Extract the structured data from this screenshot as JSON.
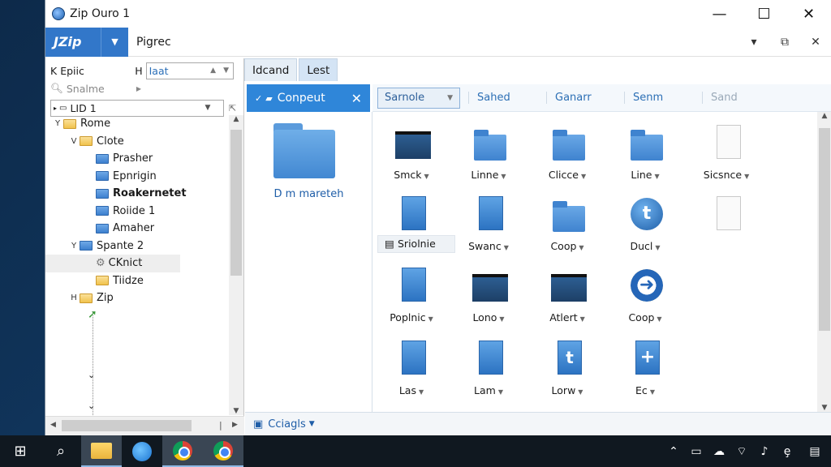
{
  "window": {
    "title": "Zip Ouro 1"
  },
  "ribbon": {
    "app_menu": "JZip",
    "tab": "Pigrec"
  },
  "left": {
    "row1": {
      "icon_label": "K",
      "left_text": "Epiic",
      "right_prefix": "H",
      "right_text": "Iaat"
    },
    "row2": {
      "text": "Snalme"
    },
    "address": {
      "value": "LID 1"
    },
    "tree": [
      {
        "label": "Rome",
        "indent": 0,
        "toggle": "Y",
        "folder": "yellow"
      },
      {
        "label": "Clote",
        "indent": 1,
        "toggle": "V",
        "folder": "yellow"
      },
      {
        "label": "Prasher",
        "indent": 2,
        "toggle": "",
        "folder": "blue"
      },
      {
        "label": "Epnrigin",
        "indent": 2,
        "toggle": "",
        "folder": "blue"
      },
      {
        "label": "Roakernetet",
        "indent": 2,
        "toggle": "",
        "folder": "blue",
        "bold": true
      },
      {
        "label": "Roiide 1",
        "indent": 2,
        "toggle": "",
        "folder": "blue"
      },
      {
        "label": "Amaher",
        "indent": 2,
        "toggle": "",
        "folder": "blue"
      },
      {
        "label": "Spante 2",
        "indent": 1,
        "toggle": "Y",
        "folder": "blue"
      },
      {
        "label": "CKnict",
        "indent": 2,
        "toggle": "",
        "folder": "none",
        "selected": true
      },
      {
        "label": "Tiidze",
        "indent": 2,
        "toggle": "",
        "folder": "yellow"
      },
      {
        "label": "Zip",
        "indent": 1,
        "toggle": "H",
        "folder": "yellow"
      }
    ]
  },
  "tabs": [
    {
      "label": "Idcand",
      "active": false
    },
    {
      "label": "Lest",
      "active": true
    }
  ],
  "panel": {
    "header": "Conpeut",
    "caption": "D m mareteh"
  },
  "toolbar": {
    "dropdown": "Sarnole",
    "items": [
      {
        "label": "Sahed",
        "dim": false
      },
      {
        "label": "Ganarr",
        "dim": false
      },
      {
        "label": "Senm",
        "dim": false
      },
      {
        "label": "Sand",
        "dim": true
      }
    ]
  },
  "files": [
    {
      "label": "Smck",
      "icon": "folder-dark"
    },
    {
      "label": "Linne",
      "icon": "folder-blue"
    },
    {
      "label": "Clicce",
      "icon": "folder-blue"
    },
    {
      "label": "Line",
      "icon": "folder-blue"
    },
    {
      "label": "Sicsnce",
      "icon": "doc"
    },
    {
      "label": "Sriolnie",
      "icon": "doc-blue",
      "selected": true
    },
    {
      "label": "Swanc",
      "icon": "doc-blue"
    },
    {
      "label": "Coop",
      "icon": "folder-blue"
    },
    {
      "label": "Ducl",
      "icon": "circle-t"
    },
    {
      "label": "",
      "icon": "doc"
    },
    {
      "label": "Poplnic",
      "icon": "doc-blue"
    },
    {
      "label": "Lono",
      "icon": "folder-dark"
    },
    {
      "label": "Atlert",
      "icon": "folder-dark"
    },
    {
      "label": "Coop",
      "icon": "circle-orange"
    },
    {
      "label": "",
      "icon": "none"
    },
    {
      "label": "Las",
      "icon": "doc-blue"
    },
    {
      "label": "Lam",
      "icon": "doc-blue"
    },
    {
      "label": "Lorw",
      "icon": "doc-t"
    },
    {
      "label": "Ec",
      "icon": "doc-plus"
    }
  ],
  "status": {
    "text": "Cciagls"
  },
  "taskbar": {
    "apps": [
      "start",
      "search",
      "explorer",
      "edge",
      "chrome",
      "chrome"
    ]
  }
}
